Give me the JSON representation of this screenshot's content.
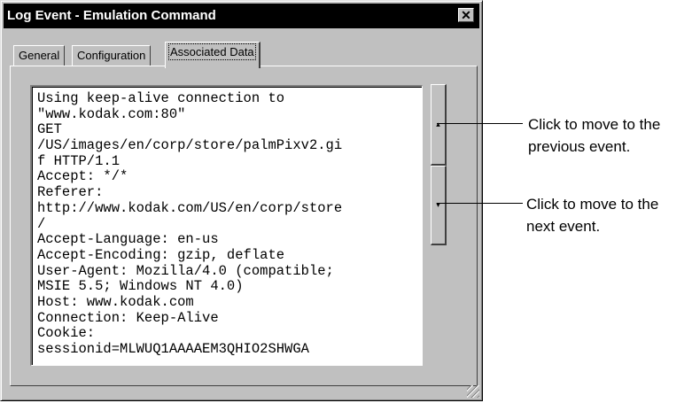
{
  "window": {
    "title": "Log Event - Emulation Command",
    "close_glyph": "✕"
  },
  "tabs": [
    {
      "label": "General",
      "active": false
    },
    {
      "label": "Configuration",
      "active": false
    },
    {
      "label": "Associated Data",
      "active": true
    }
  ],
  "associated_data_lines": [
    "Using keep-alive connection to",
    "\"www.kodak.com:80\"",
    "GET",
    "/US/images/en/corp/store/palmPixv2.gi",
    "f HTTP/1.1",
    "Accept: */*",
    "Referer:",
    "http://www.kodak.com/US/en/corp/store",
    "/",
    "Accept-Language: en-us",
    "Accept-Encoding: gzip, deflate",
    "User-Agent: Mozilla/4.0 (compatible;",
    "MSIE 5.5; Windows NT 4.0)",
    "Host: www.kodak.com",
    "Connection: Keep-Alive",
    "Cookie:",
    "sessionid=MLWUQ1AAAAEM3QHIO2SHWGA"
  ],
  "navigation": {
    "prev_icon": "up-arrow-icon",
    "prev_glyph": "▴",
    "next_icon": "down-arrow-icon",
    "next_glyph": "▾"
  },
  "callouts": {
    "previous": {
      "line1": "Click to move to the",
      "line2": "previous event."
    },
    "next": {
      "line1": "Click to move to the",
      "line2": "next event."
    }
  }
}
